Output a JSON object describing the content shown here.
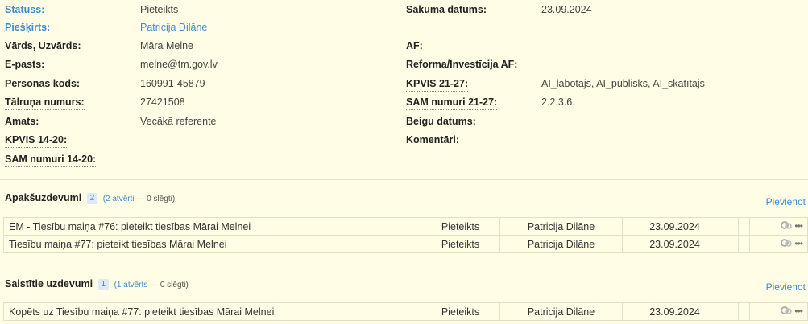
{
  "attributes": {
    "left": [
      {
        "label": "Statuss:",
        "value": "Pieteikts"
      },
      {
        "label": "Piešķirts:",
        "value": "Patricija Dilāne"
      },
      {
        "label": "Vārds, Uzvārds:",
        "value": "Māra Melne"
      },
      {
        "label": "E-pasts:",
        "value": "melne@tm.gov.lv"
      },
      {
        "label": "Personas kods:",
        "value": "160991-45879"
      },
      {
        "label": "Tālruņa numurs:",
        "value": "27421508"
      },
      {
        "label": "Amats:",
        "value": "Vecākā referente"
      },
      {
        "label": "KPVIS 14-20:",
        "value": ""
      },
      {
        "label": "SAM numuri 14-20:",
        "value": ""
      }
    ],
    "right": [
      {
        "label": "Sākuma datums:",
        "value": "23.09.2024"
      },
      {
        "label": "AF:",
        "value": ""
      },
      {
        "label": "Reforma/Investīcija AF:",
        "value": ""
      },
      {
        "label": "KPVIS 21-27:",
        "value": "AI_labotājs, AI_publisks, AI_skatītājs"
      },
      {
        "label": "SAM numuri 21-27:",
        "value": "2.2.3.6."
      },
      {
        "label": "Beigu datums:",
        "value": ""
      },
      {
        "label": "Komentāri:",
        "value": ""
      }
    ]
  },
  "subtasks": {
    "title": "Apakšuzdevumi",
    "count": "2",
    "open_link": "(2 atvērti",
    "closed_text": "— 0 slēgti)",
    "add_label": "Pievienot",
    "rows": [
      {
        "prefix": "EM - ",
        "title": "Tiesību maiņa #76: pieteikt tiesības Mārai Melnei",
        "status": "Pieteikts",
        "assignee": "Patricija Dilāne",
        "date": "23.09.2024"
      },
      {
        "prefix": "",
        "title": "Tiesību maiņa #77: pieteikt tiesības Mārai Melnei",
        "status": "Pieteikts",
        "assignee": "Patricija Dilāne",
        "date": "23.09.2024"
      }
    ]
  },
  "related": {
    "title": "Saistītie uzdevumi",
    "count": "1",
    "open_link": "(1 atvērts",
    "closed_text": "— 0 slēgti)",
    "add_label": "Pievienot",
    "rows": [
      {
        "prefix": "Kopēts uz ",
        "title": "Tiesību maiņa #77: pieteikt tiesības Mārai Melnei",
        "status": "Pieteikts",
        "assignee": "Patricija Dilāne",
        "date": "23.09.2024"
      }
    ]
  },
  "icons": {
    "row_action": "gear-icon",
    "row_more": "more-dots-icon"
  },
  "colors": {
    "background": "#fffde6",
    "link": "#3d8ad0",
    "border": "#e3dfc3"
  }
}
